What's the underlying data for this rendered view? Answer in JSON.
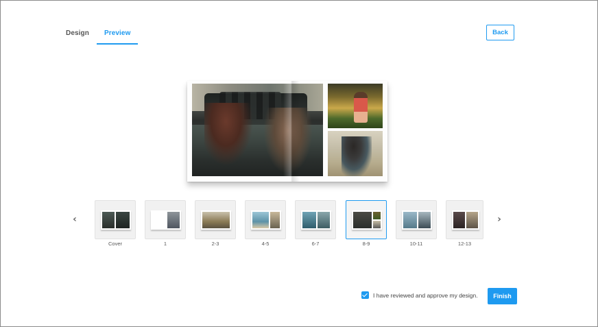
{
  "tabs": [
    {
      "label": "Design",
      "active": false
    },
    {
      "label": "Preview",
      "active": true
    }
  ],
  "header": {
    "back_label": "Back"
  },
  "nav": {
    "prev_icon": "chevron-left-icon",
    "next_icon": "chevron-right-icon",
    "prev_glyph": "‹",
    "next_glyph": "›"
  },
  "thumbnails": [
    {
      "label": "Cover",
      "selected": false
    },
    {
      "label": "1",
      "selected": false
    },
    {
      "label": "2-3",
      "selected": false
    },
    {
      "label": "4-5",
      "selected": false
    },
    {
      "label": "6-7",
      "selected": false
    },
    {
      "label": "8-9",
      "selected": true
    },
    {
      "label": "10-11",
      "selected": false
    },
    {
      "label": "12-13",
      "selected": false
    }
  ],
  "approval": {
    "checked": true,
    "text": "I have reviewed and approve my design."
  },
  "footer": {
    "finish_label": "Finish"
  },
  "colors": {
    "accent": "#1e9af0",
    "border": "#8a8a8a"
  }
}
